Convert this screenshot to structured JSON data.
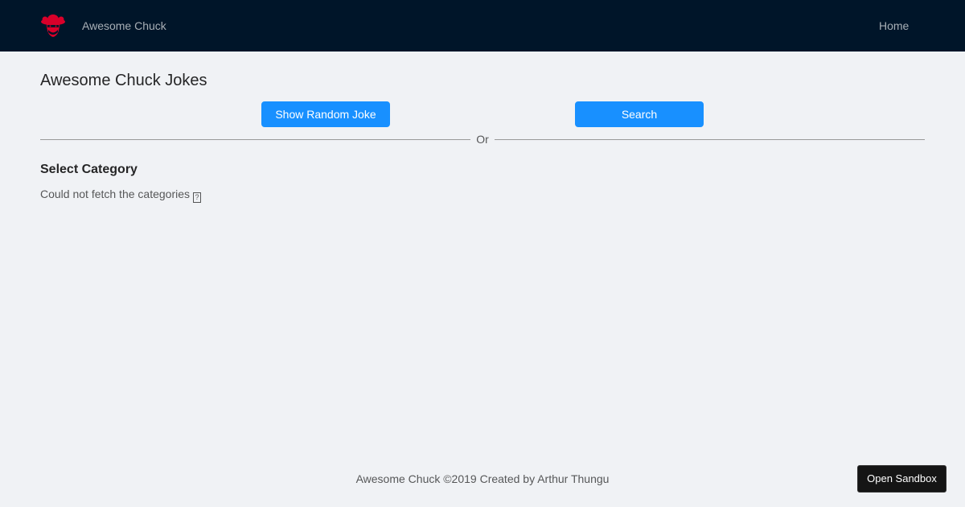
{
  "header": {
    "brand": "Awesome Chuck",
    "nav": {
      "home": "Home"
    }
  },
  "main": {
    "title": "Awesome Chuck Jokes",
    "random_button": "Show Random Joke",
    "search_button": "Search",
    "divider_text": "Or",
    "category_title": "Select Category",
    "category_error": "Could not fetch the categories",
    "missing_glyph": "?"
  },
  "footer": {
    "text": "Awesome Chuck ©2019 Created by Arthur Thungu"
  },
  "sandbox": {
    "label": "Open Sandbox"
  },
  "colors": {
    "header_bg": "#001529",
    "primary": "#1890ff",
    "logo": "#d9002a",
    "page_bg": "#f0f2f5"
  }
}
